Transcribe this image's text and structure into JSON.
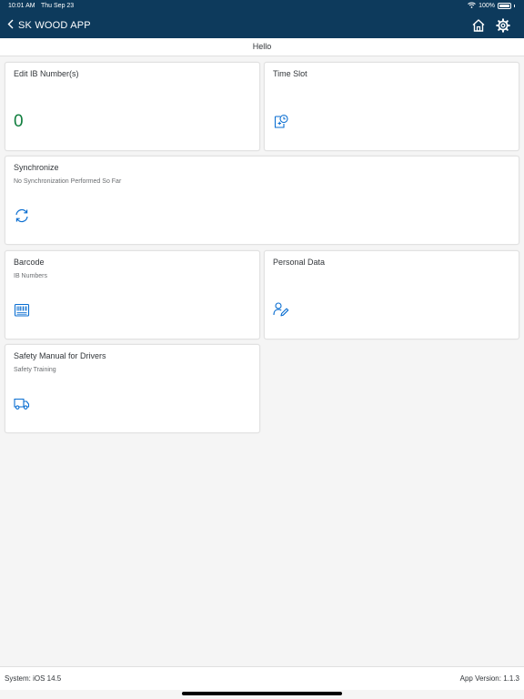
{
  "status_bar": {
    "time": "10:01 AM",
    "date": "Thu Sep 23",
    "battery": "100%"
  },
  "header": {
    "title": "SK WOOD APP",
    "background": "#0d3a5c"
  },
  "sub_header": {
    "greeting": "Hello"
  },
  "tiles": [
    {
      "title": "Edit IB Number(s)",
      "kpi": "0",
      "kpi_color": "#107e3e"
    },
    {
      "title": "Time Slot",
      "icon": "appointment-icon"
    },
    {
      "title": "Synchronize",
      "subtitle": "No Synchronization Performed So Far",
      "icon": "sync-icon"
    },
    {
      "title": "Barcode",
      "subtitle": "IB Numbers",
      "icon": "barcode-icon"
    },
    {
      "title": "Personal Data",
      "icon": "edit-person-icon"
    },
    {
      "title": "Safety Manual for Drivers",
      "subtitle": "Safety Training",
      "icon": "truck-icon"
    }
  ],
  "footer": {
    "system": "System: iOS 14.5",
    "version": "App Version: 1.1.3"
  },
  "icon_color": "#0a6ed1"
}
